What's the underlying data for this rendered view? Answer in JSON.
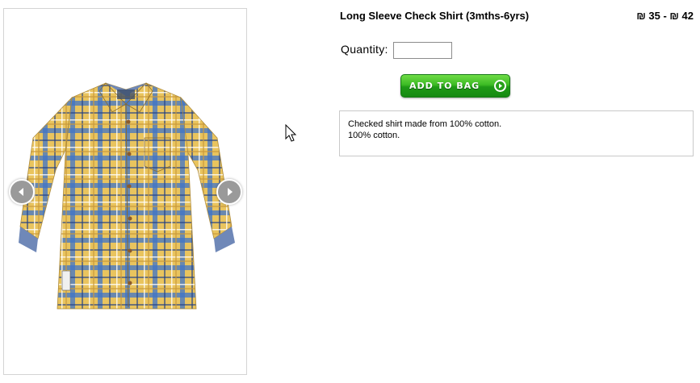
{
  "product": {
    "title": "Long Sleeve Check Shirt (3mths-6yrs)",
    "price": "₪ 35 - ₪ 42"
  },
  "quantity": {
    "label": "Quantity:",
    "value": ""
  },
  "add_to_bag": {
    "label": "ADD TO BAG"
  },
  "description": {
    "line1": "Checked shirt made from 100% cotton.",
    "line2": "100% cotton."
  },
  "gallery": {
    "image": "plaid-shirt-image",
    "prev_icon": "chevron-left-icon",
    "next_icon": "chevron-right-icon"
  },
  "colors": {
    "button_green": "#2fae1c",
    "shirt_yellow": "#e8c25a",
    "shirt_blue": "#3a6fc4",
    "cuff_denim": "#6f88b8"
  }
}
